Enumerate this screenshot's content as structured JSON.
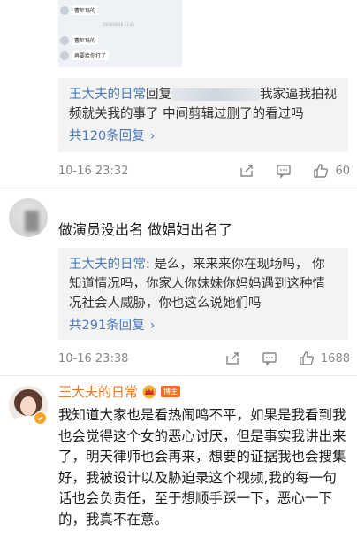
{
  "thread1": {
    "chat_screenshot": {
      "timestamp": "2020/09/18 11:25",
      "messages": [
        "曹尼玛的",
        "曹尼玛的",
        "再要给你打了"
      ]
    },
    "reply": {
      "author": "王大夫的日常",
      "text_a": "回复",
      "text_b": "我家逼我拍视频就关我的事了 中间剪辑过删了的看过吗",
      "more": "共120条回复",
      "more_icon": "chevron-right"
    },
    "time": "10-16 23:32",
    "likes": "60"
  },
  "comment2": {
    "text": "做演员没出名 做娼妇出名了",
    "reply": {
      "author": "王大夫的日常",
      "text": ": 是么，来来来你在现场吗， 你知道情况吗，你家人你妹妹你妈妈遇到这种情况社会人威胁，你也这么说她们吗",
      "more": "共291条回复",
      "more_icon": "chevron-right"
    },
    "time": "10-16 23:38",
    "likes": "1688"
  },
  "comment3": {
    "author": "王大夫的日常",
    "badge": "博主",
    "text": "我知道大家也是看热闹鸣不平，如果是我看到我也会觉得这个女的恶心讨厌，但是事实我讲出来了，明天律师也会再来，想要的证据我也会搜集好，我被设计以及胁迫录这个视频,我的每一句话也会负责任，至于想顺手踩一下，恶心一下的，我真不在意。"
  },
  "icons": {
    "share": "share-icon",
    "comment": "comment-icon",
    "like": "thumbs-up-icon",
    "crown": "crown-icon",
    "verified": "verified-icon"
  },
  "colors": {
    "username_blue": "#4b7ab8",
    "author_orange": "#e07a28",
    "badge_orange": "#f26f22",
    "reply_bg": "#f3f3f3"
  }
}
